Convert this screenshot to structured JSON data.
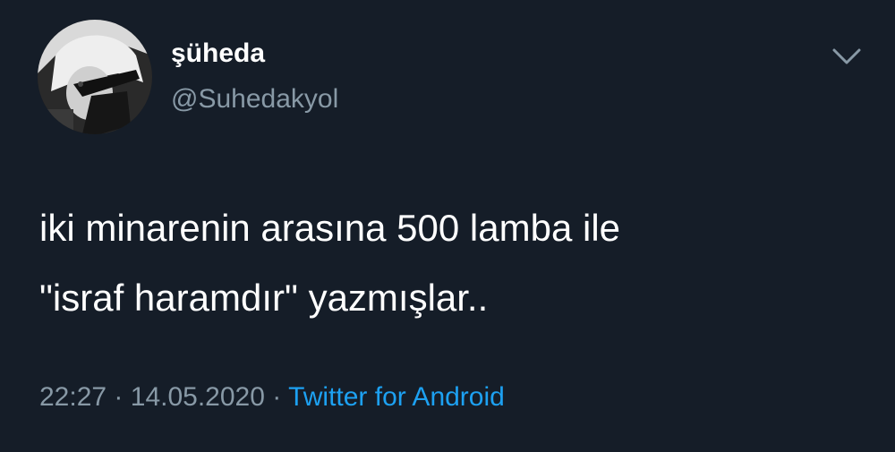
{
  "user": {
    "display_name": "şüheda",
    "handle": "@Suhedakyol",
    "avatar_icon": "profile-photo"
  },
  "tweet": {
    "lines": [
      "iki minarenin arasına 500 lamba ile",
      "\"israf haramdır\" yazmışlar.."
    ]
  },
  "meta": {
    "time": "22:27",
    "separator": "·",
    "date": "14.05.2020",
    "source": "Twitter for Android"
  },
  "icons": {
    "more": "chevron-down-icon"
  },
  "colors": {
    "background": "#151d28",
    "primary_text": "#ffffff",
    "secondary_text": "#8899a6",
    "link": "#1da1f2"
  }
}
